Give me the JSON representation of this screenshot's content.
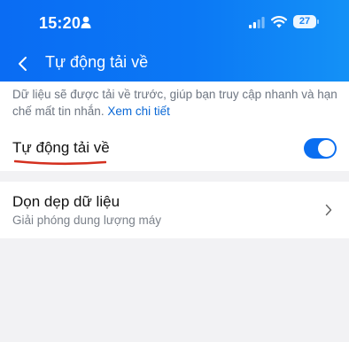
{
  "status_bar": {
    "time": "15:20",
    "battery_level": "27",
    "icons": [
      "person-icon",
      "signal-icon",
      "wifi-icon",
      "battery-icon"
    ]
  },
  "nav": {
    "back_icon": "chevron-left-icon",
    "title": "Tự động tải về"
  },
  "description": {
    "text": "Dữ liệu sẽ được tải về trước, giúp bạn truy cập nhanh và hạn chế mất tin nhắn.",
    "link": "Xem chi tiết"
  },
  "auto_download": {
    "label": "Tự động tải về",
    "enabled": true
  },
  "cleanup": {
    "title": "Dọn dẹp dữ liệu",
    "subtitle": "Giải phóng dung lượng máy",
    "icon": "chevron-right-icon"
  },
  "colors": {
    "header": "#0b78f5",
    "toggle_on": "#0a6ef0",
    "link": "#0a68d6",
    "annotation": "#d4301f",
    "background": "#f2f2f4"
  }
}
